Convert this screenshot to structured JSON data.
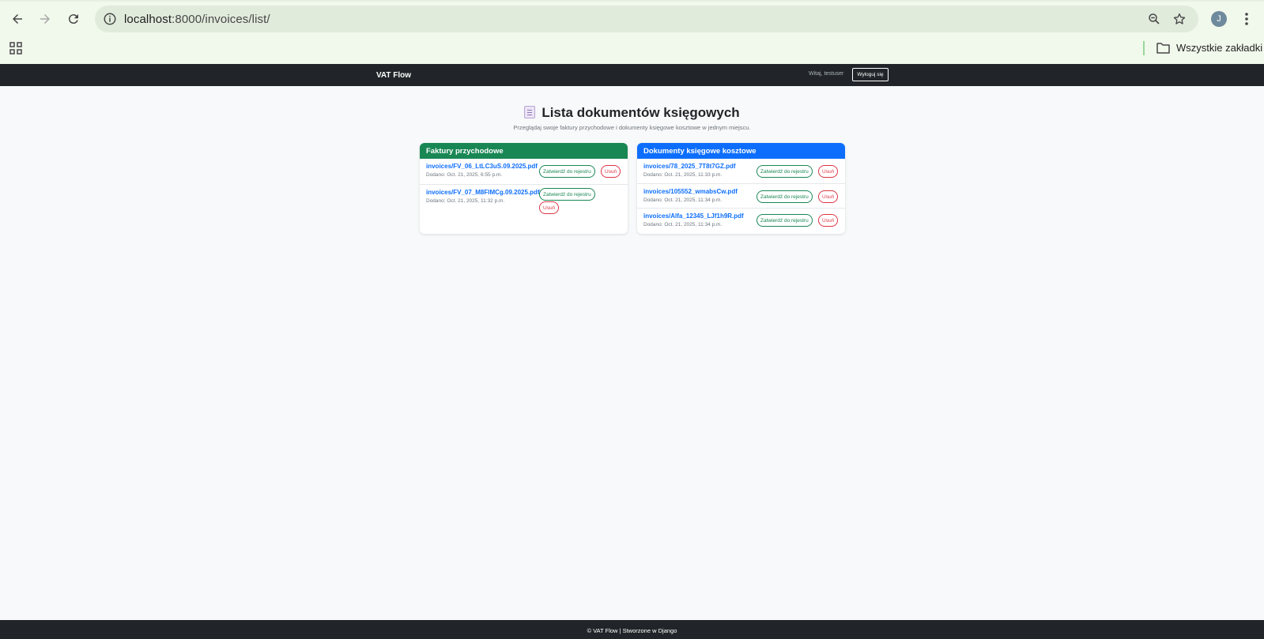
{
  "browser": {
    "url_host": "localhost",
    "url_rest": ":8000/invoices/list/",
    "avatar_letter": "J",
    "bookmarks_label": "Wszystkie zakładki"
  },
  "navbar": {
    "brand": "VAT Flow",
    "welcome": "Witaj, testuser",
    "logout_label": "Wyloguj się"
  },
  "page": {
    "title": "Lista dokumentów księgowych",
    "subtitle": "Przeglądaj swoje faktury przychodowe i dokumenty księgowe kosztowe w jednym miejscu."
  },
  "income": {
    "heading": "Faktury przychodowe",
    "items": [
      {
        "name": "invoices/FV_06_LtLC3uS.09.2025.pdf",
        "date": "Dodano: Oct. 21, 2025, 6:55 p.m.",
        "approve": "Zatwierdź do rejestru",
        "delete": "Usuń"
      },
      {
        "name": "invoices/FV_07_M8FlMCg.09.2025.pdf",
        "date": "Dodano: Oct. 21, 2025, 11:32 p.m.",
        "approve": "Zatwierdź do rejestru",
        "delete": "Usuń"
      }
    ]
  },
  "cost": {
    "heading": "Dokumenty księgowe kosztowe",
    "items": [
      {
        "name": "invoices/78_2025_7T8t7GZ.pdf",
        "date": "Dodano: Oct. 21, 2025, 11:33 p.m.",
        "approve": "Zatwierdź do rejestru",
        "delete": "Usuń"
      },
      {
        "name": "invoices/105552_wmabsCw.pdf",
        "date": "Dodano: Oct. 21, 2025, 11:34 p.m.",
        "approve": "Zatwierdź do rejestru",
        "delete": "Usuń"
      },
      {
        "name": "invoices/Alfa_12345_LJf1h9R.pdf",
        "date": "Dodano: Oct. 21, 2025, 11:34 p.m.",
        "approve": "Zatwierdź do rejestru",
        "delete": "Usuń"
      }
    ]
  },
  "footer": {
    "text": "© VAT Flow | Stworzone w Django"
  }
}
